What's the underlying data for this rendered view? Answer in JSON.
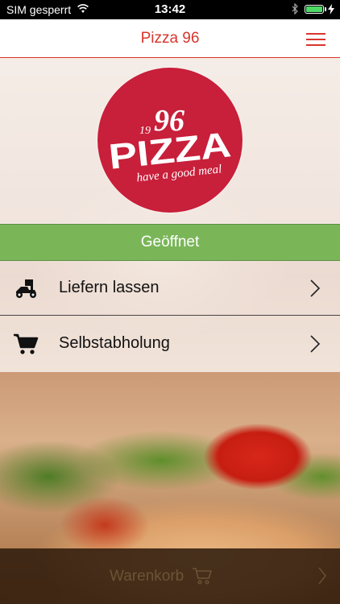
{
  "status_bar": {
    "carrier": "SIM gesperrt",
    "time": "13:42",
    "battery_level": 1.0,
    "battery_color": "#4cd964",
    "icons": [
      "wifi-icon",
      "bluetooth-icon",
      "battery-icon",
      "charging-bolt-icon"
    ]
  },
  "nav": {
    "title": "Pizza 96",
    "menu_icon": "hamburger-menu-icon",
    "accent_color": "#d8352c"
  },
  "logo": {
    "color": "#c81f3a",
    "text_main": "PIZZA",
    "text_year_left": "19",
    "text_year_right": "96",
    "tagline": "have a good meal"
  },
  "status_banner": {
    "label": "Geöffnet",
    "color": "#7ab658"
  },
  "options": [
    {
      "label": "Liefern lassen",
      "icon": "delivery-scooter-icon"
    },
    {
      "label": "Selbstabholung",
      "icon": "shopping-cart-icon"
    }
  ],
  "cart_bar": {
    "label": "Warenkorb",
    "icon": "shopping-cart-icon",
    "chevron": "chevron-right-icon"
  }
}
